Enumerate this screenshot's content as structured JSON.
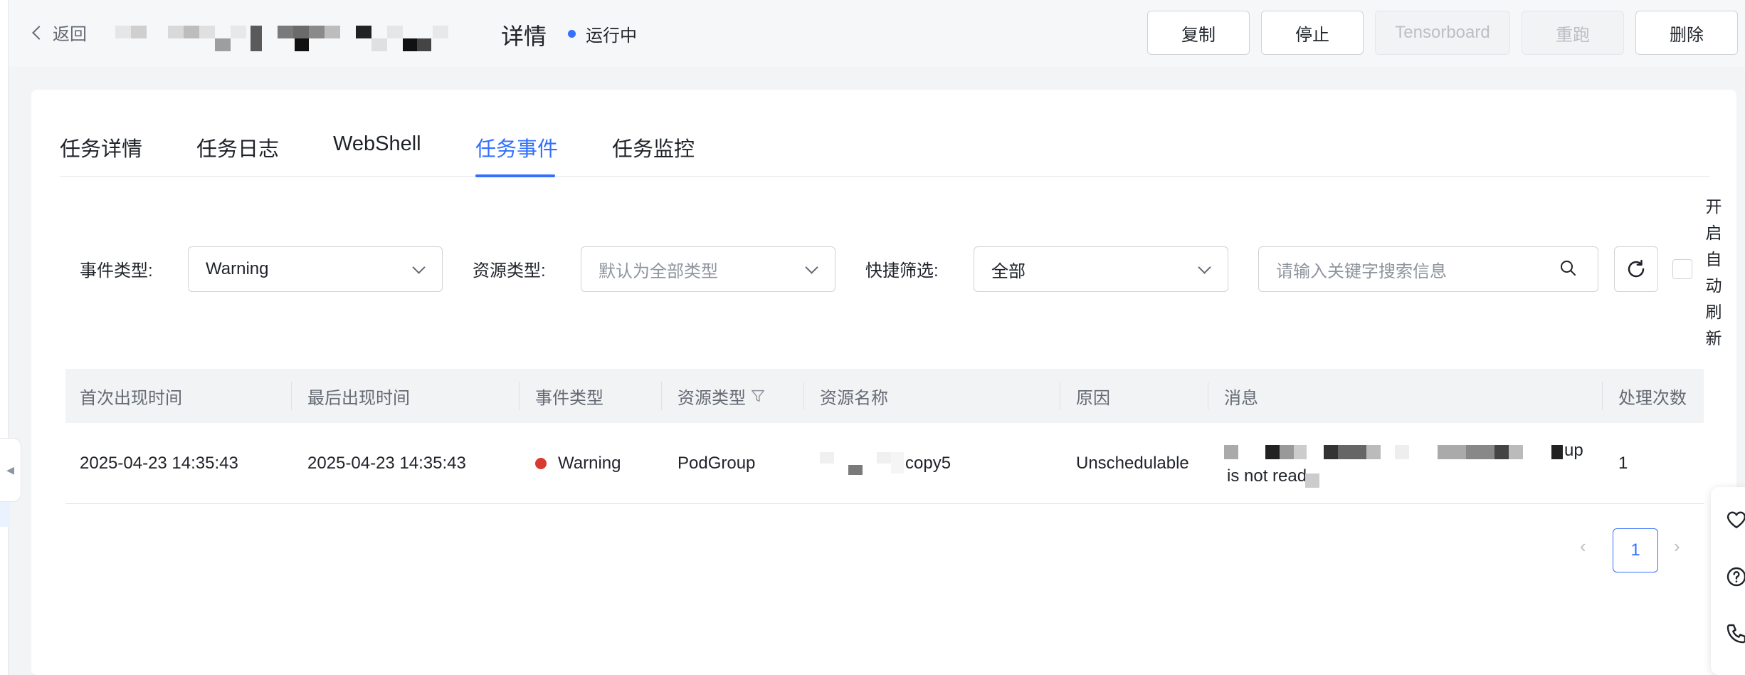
{
  "header": {
    "back_label": "返回",
    "title_suffix": "详情",
    "status_label": "运行中",
    "buttons": {
      "copy": "复制",
      "stop": "停止",
      "tensorboard": "Tensorboard",
      "rerun": "重跑",
      "delete": "删除"
    }
  },
  "tabs": [
    "任务详情",
    "任务日志",
    "WebShell",
    "任务事件",
    "任务监控"
  ],
  "active_tab": "任务事件",
  "filters": {
    "event_type_label": "事件类型:",
    "event_type_value": "Warning",
    "resource_type_label": "资源类型:",
    "resource_type_placeholder": "默认为全部类型",
    "quick_filter_label": "快捷筛选:",
    "quick_filter_value": "全部",
    "search_placeholder": "请输入关键字搜索信息",
    "auto_refresh_label": "开启自动刷新"
  },
  "table": {
    "columns": [
      "首次出现时间",
      "最后出现时间",
      "事件类型",
      "资源类型",
      "资源名称",
      "原因",
      "消息",
      "处理次数"
    ],
    "rows": [
      {
        "first_seen": "2025-04-23 14:35:43",
        "last_seen": "2025-04-23 14:35:43",
        "event_type": "Warning",
        "resource_type": "PodGroup",
        "resource_name_visible": "copy5",
        "reason": "Unschedulable",
        "message_visible_end": "up",
        "message_visible_line2": "is not read",
        "count": "1"
      }
    ]
  },
  "pagination": {
    "current_page": "1"
  },
  "colors": {
    "accent": "#3370ff",
    "warning": "#d83931",
    "text": "#1f2329",
    "muted": "#646a73",
    "border": "#d0d3d6"
  },
  "icons": [
    "chevron-left-icon",
    "status-dot-icon",
    "chevron-down-icon",
    "search-icon",
    "refresh-icon",
    "filter-icon",
    "warning-dot-icon",
    "chevron-right-icon",
    "heart-icon",
    "help-icon",
    "phone-icon"
  ]
}
